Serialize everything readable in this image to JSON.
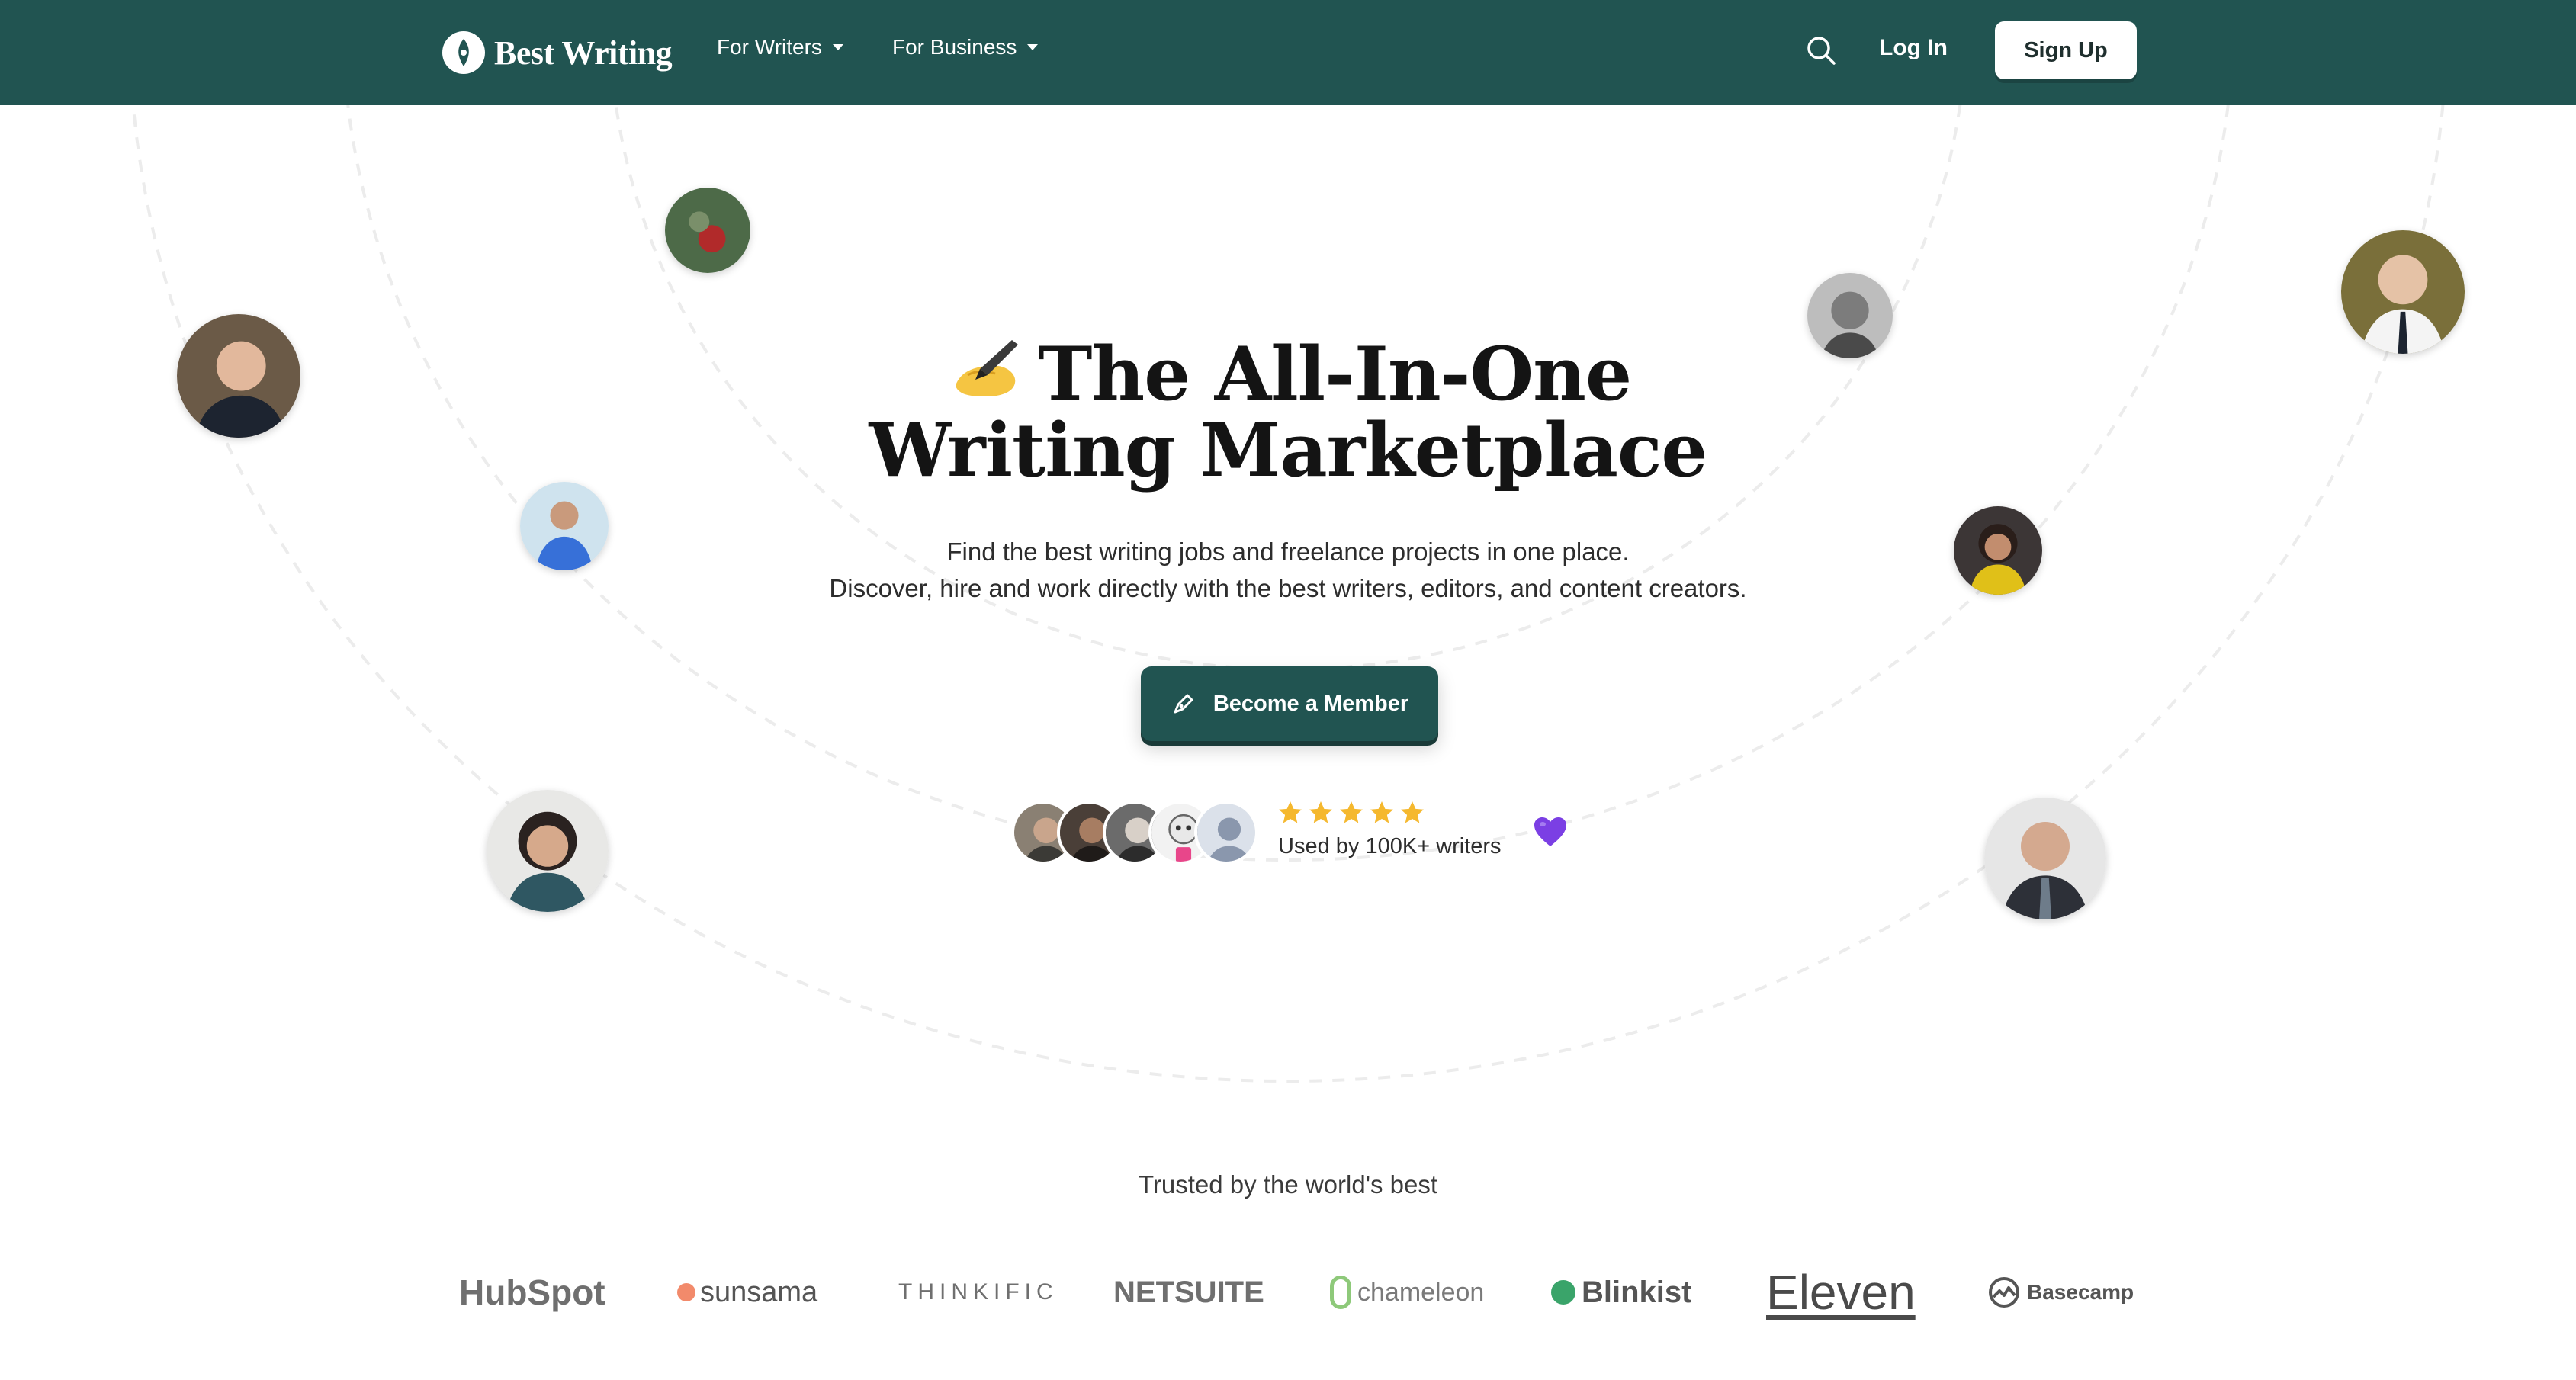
{
  "nav": {
    "logo_text": "Best Writing",
    "for_writers": "For Writers",
    "for_business": "For Business",
    "login": "Log In",
    "signup": "Sign Up"
  },
  "hero": {
    "title_line1": "The All-In-One",
    "title_line2": "Writing Marketplace",
    "subtitle_line1": "Find the best writing jobs and freelance projects in one place.",
    "subtitle_line2": "Discover, hire and work directly with the best writers, editors, and content creators.",
    "cta": "Become a Member"
  },
  "social_proof": {
    "rating_stars": 5,
    "text": "Used by 100K+ writers"
  },
  "trusted": {
    "heading": "Trusted by the world's best",
    "brands": [
      "HubSpot",
      "sunsama",
      "THINKIFIC",
      "NETSUITE",
      "chameleon",
      "Blinkist",
      "Eleven",
      "Basecamp"
    ]
  },
  "colors": {
    "brand_green": "#215451",
    "star": "#f5b82e",
    "heart": "#7b3fe4"
  }
}
